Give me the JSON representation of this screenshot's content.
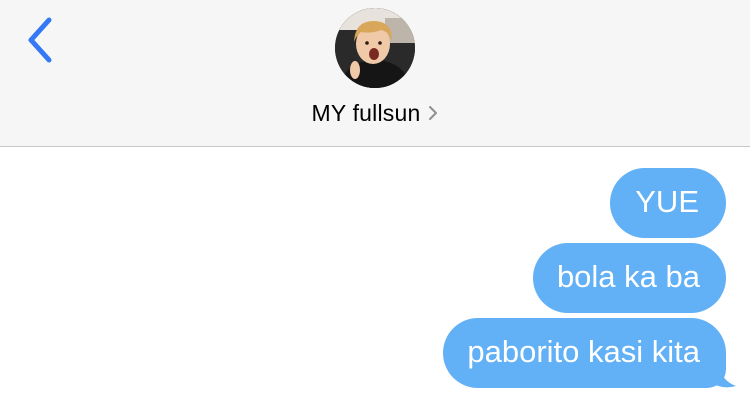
{
  "header": {
    "back_icon": "chevron-left-icon",
    "contact_name": "MY fullsun",
    "contact_chevron_icon": "chevron-right-icon",
    "avatar": "contact-avatar-photo"
  },
  "messages": [
    {
      "direction": "outgoing",
      "text": "YUE"
    },
    {
      "direction": "outgoing",
      "text": "bola ka ba"
    },
    {
      "direction": "outgoing",
      "text": "paborito kasi kita"
    }
  ],
  "colors": {
    "accent": "#3478f6",
    "bubble_outgoing": "#62b0f5",
    "header_bg": "#f6f6f7",
    "divider": "#c8c8cc"
  }
}
